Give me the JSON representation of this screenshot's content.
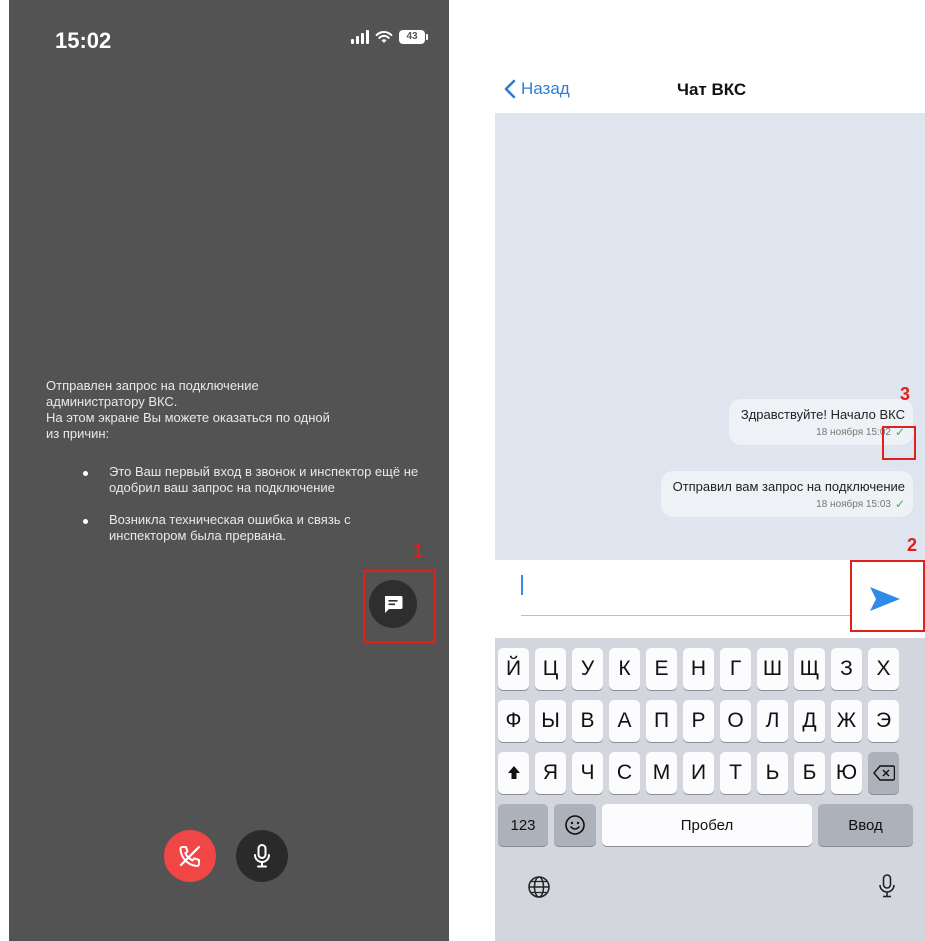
{
  "left_screen": {
    "status": {
      "time": "15:02",
      "battery": "43"
    },
    "info": {
      "line1": "Отправлен запрос на подключение",
      "line2": "администратору ВКС.",
      "line3": "На этом экране Вы можете оказаться по одной",
      "line4": "из причин:",
      "reasons": [
        "Это Ваш первый вход в звонок и инспектор ещё не одобрил ваш запрос на подключение",
        "Возникла техническая ошибка и связь с инспектором была прервана."
      ]
    },
    "callout_1": "1"
  },
  "right_screen": {
    "nav": {
      "back_label": "Назад",
      "title": "Чат ВКС"
    },
    "messages": [
      {
        "text": "Здравствуйте! Начало ВКС",
        "time": "18 ноября 15:02"
      },
      {
        "text": "Отправил вам запрос на подключение",
        "time": "18 ноября 15:03"
      }
    ],
    "callout_2": "2",
    "callout_3": "3",
    "input": {
      "value": ""
    },
    "keyboard": {
      "row1": [
        "Й",
        "Ц",
        "У",
        "К",
        "Е",
        "Н",
        "Г",
        "Ш",
        "Щ",
        "З",
        "Х"
      ],
      "row2": [
        "Ф",
        "Ы",
        "В",
        "А",
        "П",
        "Р",
        "О",
        "Л",
        "Д",
        "Ж",
        "Э"
      ],
      "row3": [
        "Я",
        "Ч",
        "С",
        "М",
        "И",
        "Т",
        "Ь",
        "Б",
        "Ю"
      ],
      "numbers_label": "123",
      "space_label": "Пробел",
      "return_label": "Ввод"
    }
  },
  "colors": {
    "left_background": "#535353",
    "accent_blue": "#2f7ed8",
    "hangup_red": "#f04646",
    "highlight_red": "#e0201b",
    "read_check_green": "#3dba4e",
    "chat_background": "#dfe5ee"
  },
  "icons": {
    "chat": "chat-bubble-icon",
    "hangup": "phone-hangup-icon",
    "mic": "microphone-icon",
    "send": "send-arrow-icon",
    "back": "chevron-left-icon",
    "shift": "shift-icon",
    "backspace": "backspace-icon",
    "emoji": "emoji-icon",
    "globe": "globe-icon",
    "dictation": "dictation-mic-icon"
  }
}
